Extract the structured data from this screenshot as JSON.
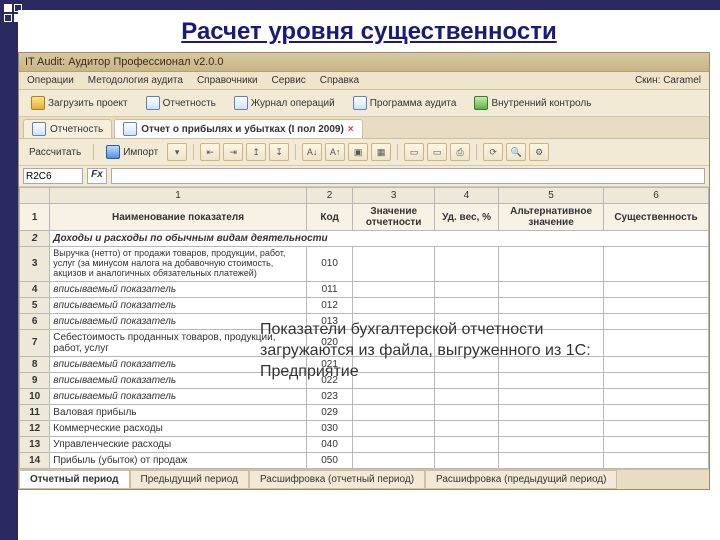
{
  "slide": {
    "title": "Расчет уровня существенности"
  },
  "titlebar": "IT Audit: Аудитор Профессионал v2.0.0",
  "menu": {
    "m1": "Операции",
    "m2": "Методология аудита",
    "m3": "Справочники",
    "m4": "Сервис",
    "m5": "Справка",
    "skin": "Скин: Caramel"
  },
  "toolbar": {
    "load": "Загрузить проект",
    "report": "Отчетность",
    "journal": "Журнал операций",
    "program": "Программа аудита",
    "control": "Внутренний контроль"
  },
  "tabs": {
    "t1": "Отчетность",
    "t2": "Отчет о прибылях и убытках (I пол 2009)"
  },
  "toolbar2": {
    "calc": "Рассчитать",
    "import": "Импорт"
  },
  "cellref": {
    "ref": "R2C6",
    "fx": "Fx"
  },
  "columns": {
    "c1": "1",
    "c2": "2",
    "c3": "3",
    "c4": "4",
    "c5": "5",
    "c6": "6"
  },
  "headers": {
    "h1": "Наименование показателя",
    "h2": "Код",
    "h3": "Значение отчетности",
    "h4": "Уд. вес, %",
    "h5": "Альтернативное значение",
    "h6": "Существенность"
  },
  "rows": [
    {
      "n": "1",
      "type": "hdr"
    },
    {
      "n": "2",
      "type": "section",
      "name": "Доходы и расходы по обычным видам деятельности"
    },
    {
      "n": "3",
      "name": "Выручка (нетто) от продажи товаров, продукции, работ, услуг (за минусом налога на добавочную стоимость, акцизов и аналогичных обязательных платежей)",
      "code": "010"
    },
    {
      "n": "4",
      "name": "вписываемый показатель",
      "code": "011",
      "ital": true
    },
    {
      "n": "5",
      "name": "вписываемый показатель",
      "code": "012",
      "ital": true
    },
    {
      "n": "6",
      "name": "вписываемый показатель",
      "code": "013",
      "ital": true
    },
    {
      "n": "7",
      "name": "Себестоимость проданных товаров, продукции, работ, услуг",
      "code": "020"
    },
    {
      "n": "8",
      "name": "вписываемый показатель",
      "code": "021",
      "ital": true
    },
    {
      "n": "9",
      "name": "вписываемый показатель",
      "code": "022",
      "ital": true
    },
    {
      "n": "10",
      "name": "вписываемый показатель",
      "code": "023",
      "ital": true
    },
    {
      "n": "11",
      "name": "Валовая прибыль",
      "code": "029"
    },
    {
      "n": "12",
      "name": "Коммерческие расходы",
      "code": "030"
    },
    {
      "n": "13",
      "name": "Управленческие расходы",
      "code": "040"
    },
    {
      "n": "14",
      "name": "Прибыль (убыток) от продаж",
      "code": "050"
    }
  ],
  "overlay": "Показатели бухгалтерской отчетности загружаются из файла, выгруженного из 1С: Предприятие",
  "bottomtabs": {
    "b1": "Отчетный период",
    "b2": "Предыдущий период",
    "b3": "Расшифровка (отчетный период)",
    "b4": "Расшифровка (предыдущий период)"
  }
}
